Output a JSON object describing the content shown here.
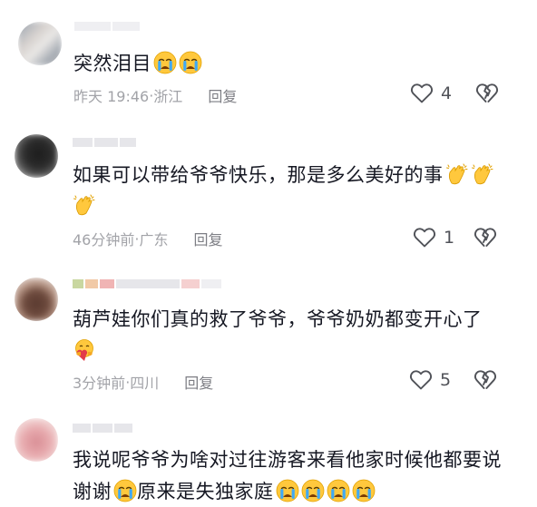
{
  "comments": [
    {
      "text": "突然泪目",
      "emojis": [
        "crying-face",
        "crying-face"
      ],
      "time": "昨天 19:46",
      "location": "浙江",
      "reply_label": "回复",
      "likes": "4"
    },
    {
      "text_line1": "如果可以带给爷爷快乐，那是多么美好的事",
      "emojis": [
        "clapping-hands",
        "clapping-hands",
        "clapping-hands"
      ],
      "time": "46分钟前",
      "location": "广东",
      "reply_label": "回复",
      "likes": "1"
    },
    {
      "text_line1": "葫芦娃你们真的救了爷爷，爷爷奶奶都变开心了",
      "emojis": [
        "hugging-heart"
      ],
      "time": "3分钟前",
      "location": "四川",
      "reply_label": "回复",
      "likes": "5"
    },
    {
      "text_line1": "我说呢爷爷为啥对过往游客来看他家时候他都要说",
      "text_line2": "谢谢",
      "text_line2b": "原来是失独家庭",
      "emojis": [
        "crying-face",
        "crying-face",
        "crying-face",
        "crying-face",
        "crying-face"
      ]
    }
  ],
  "separator": " · ",
  "colors": {
    "text": "#161823",
    "meta": "#a2a3a8",
    "reply": "#7d7e84"
  }
}
